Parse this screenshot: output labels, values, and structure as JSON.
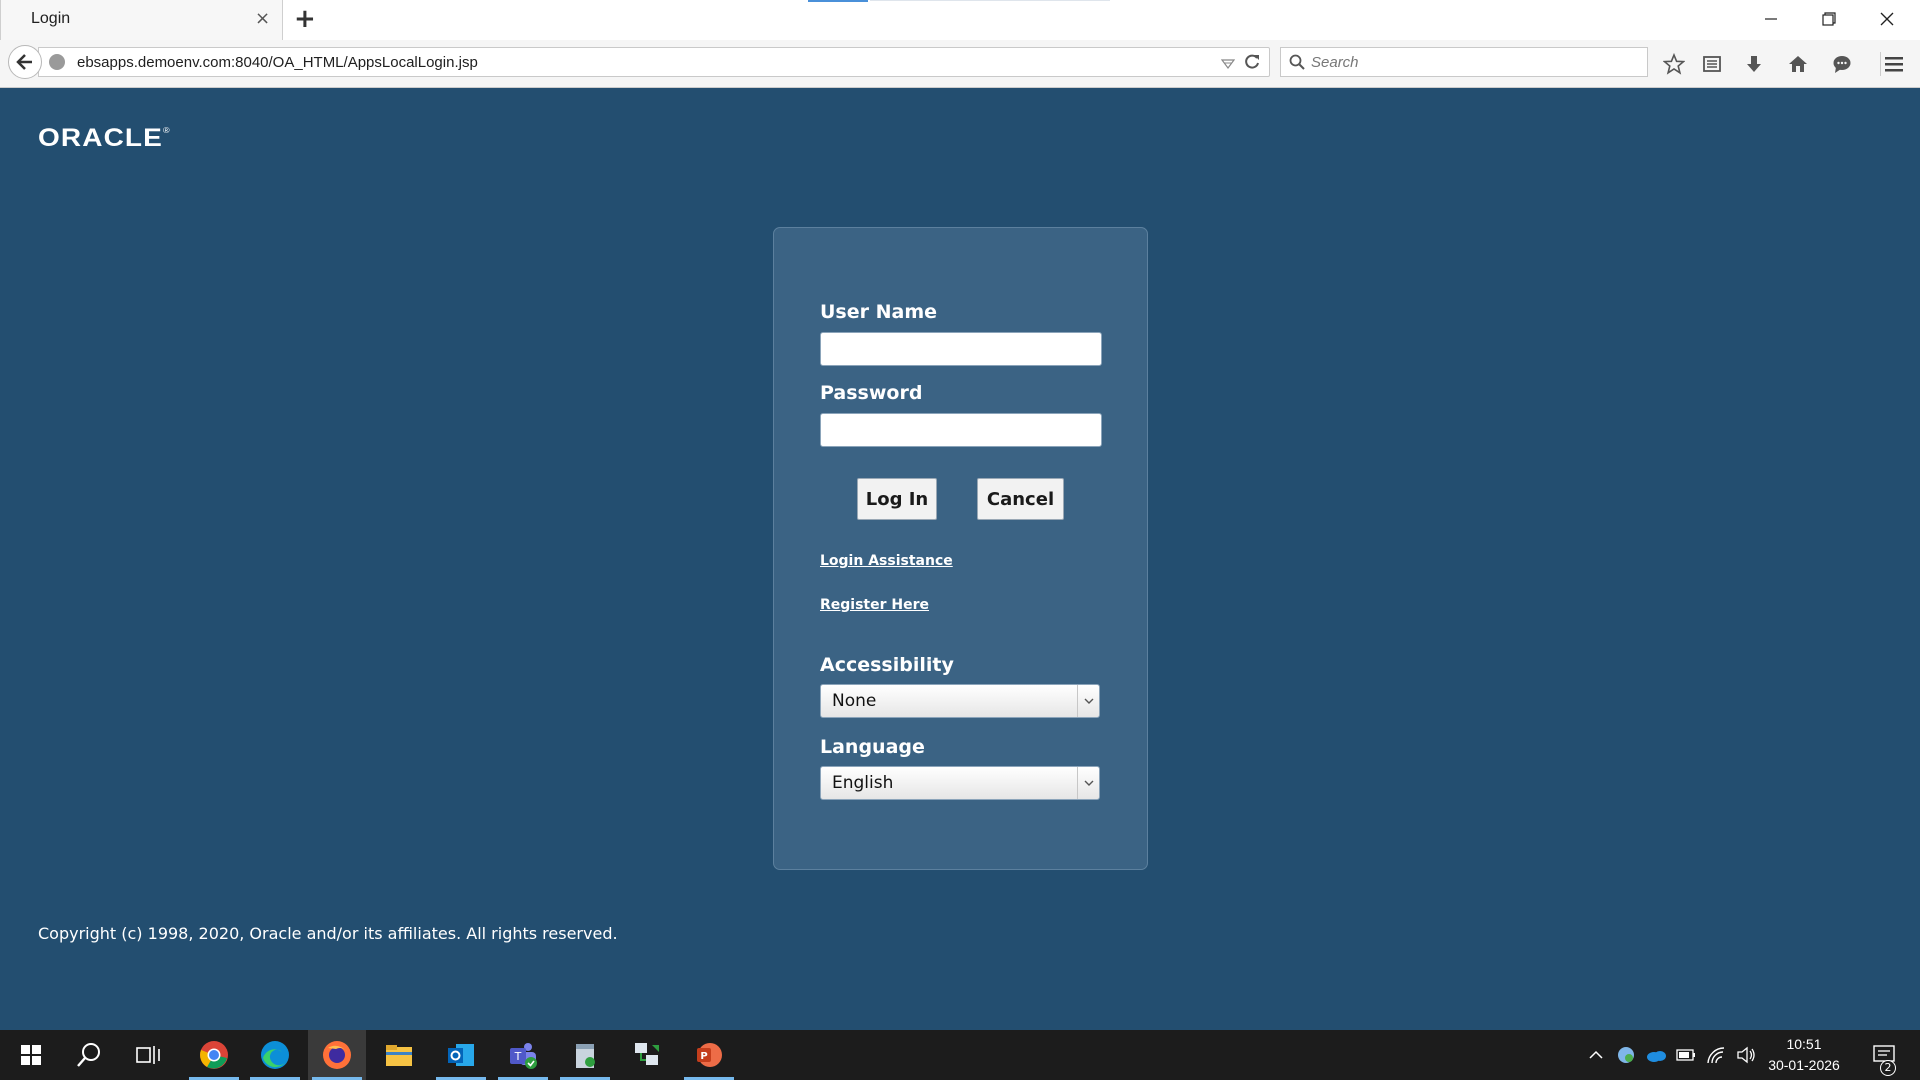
{
  "browser": {
    "tab": {
      "title": "Login",
      "close": "×"
    },
    "new_tab": "+",
    "window_controls": {
      "minimize": "minimize-icon",
      "restore": "restore-icon",
      "close": "close-icon"
    },
    "url": "ebsapps.demoenv.com:8040/OA_HTML/AppsLocalLogin.jsp",
    "search_placeholder": "Search",
    "toolbar_icons": [
      "bookmark-star-icon",
      "reading-list-icon",
      "download-icon",
      "home-icon",
      "chat-icon",
      "menu-icon"
    ]
  },
  "page": {
    "logo": "ORACLE",
    "logo_mark": "®",
    "background_color": "#234e70",
    "panel_color": "#3b6384",
    "login": {
      "username_label": "User Name",
      "username_value": "",
      "password_label": "Password",
      "password_value": "",
      "login_button": "Log In",
      "cancel_button": "Cancel",
      "login_assistance": "Login Assistance",
      "register": "Register Here",
      "accessibility_label": "Accessibility",
      "accessibility_value": "None",
      "language_label": "Language",
      "language_value": "English"
    },
    "copyright": "Copyright (c) 1998, 2020, Oracle and/or its affiliates. All rights reserved."
  },
  "taskbar": {
    "apps": [
      "start-icon",
      "search-icon",
      "task-view-icon",
      "chrome-icon",
      "edge-icon",
      "firefox-icon",
      "file-explorer-icon",
      "outlook-icon",
      "teams-icon",
      "notepad-icon",
      "network-app-icon",
      "powerpoint-icon"
    ],
    "active_app": "firefox-icon",
    "time": "10:51",
    "date": "30-01-2026",
    "notification_count": "2"
  }
}
